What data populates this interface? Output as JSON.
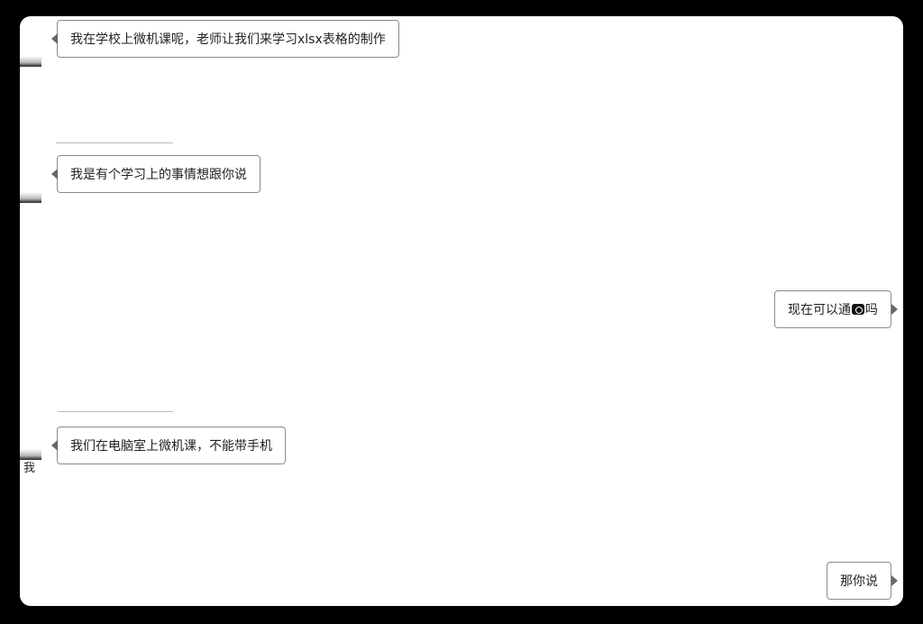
{
  "chat": {
    "messages": [
      {
        "side": "left",
        "text": "我在学校上微机课呢，老师让我们来学习xlsx表格的制作"
      },
      {
        "side": "left",
        "text": "我是有个学习上的事情想跟你说"
      },
      {
        "side": "right",
        "text_before": "现在可以通",
        "icon": "phone-icon",
        "text_after": "吗"
      },
      {
        "side": "left",
        "text": "我们在电脑室上微机课，不能带手机"
      },
      {
        "side": "right",
        "text": "那你说"
      }
    ],
    "fragment_char": "我"
  }
}
